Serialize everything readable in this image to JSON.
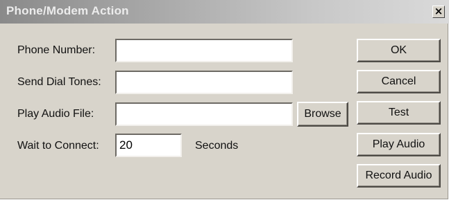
{
  "window": {
    "title": "Phone/Modem Action",
    "close_glyph": "×"
  },
  "fields": {
    "phone_number": {
      "label": "Phone Number:",
      "value": ""
    },
    "send_dial_tones": {
      "label": "Send Dial Tones:",
      "value": ""
    },
    "play_audio_file": {
      "label": "Play Audio File:",
      "value": ""
    },
    "wait_to_connect": {
      "label": "Wait to Connect:",
      "value": "20",
      "unit": "Seconds"
    }
  },
  "buttons": {
    "browse": "Browse",
    "ok": "OK",
    "cancel": "Cancel",
    "test": "Test",
    "play_audio": "Play Audio",
    "record_audio": "Record Audio"
  },
  "colors": {
    "dialog_background": "#d8d4cb",
    "titlebar_text": "#ececec"
  }
}
